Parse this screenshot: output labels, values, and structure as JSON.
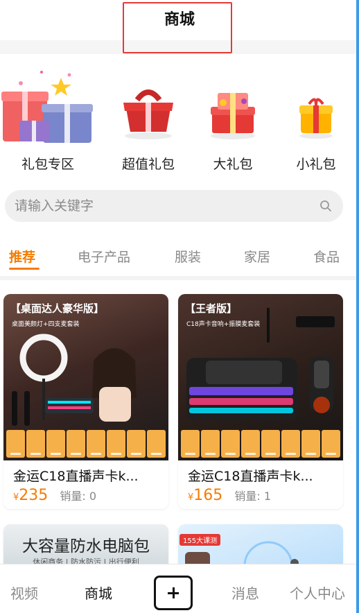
{
  "header": {
    "title": "商城"
  },
  "gift_categories": [
    {
      "label": "礼包专区",
      "icon": "gift-pile-icon"
    },
    {
      "label": "超值礼包",
      "icon": "red-gift-box-icon"
    },
    {
      "label": "大礼包",
      "icon": "big-gift-box-icon"
    },
    {
      "label": "小礼包",
      "icon": "small-gift-box-icon"
    }
  ],
  "search": {
    "placeholder": "请输入关键字",
    "value": "",
    "icon": "search-icon"
  },
  "tabs": [
    {
      "label": "推荐",
      "active": true
    },
    {
      "label": "电子产品",
      "active": false
    },
    {
      "label": "服装",
      "active": false
    },
    {
      "label": "家居",
      "active": false
    },
    {
      "label": "食品",
      "active": false
    }
  ],
  "products": [
    {
      "badge": "【桌面达人豪华版】",
      "badge_sub": "桌面美颜灯+四支麦套装",
      "title": "金运C18直播声卡k...",
      "currency": "¥",
      "price": "235",
      "sales_label": "销量:",
      "sales_count": "0"
    },
    {
      "badge": "【王者版】",
      "badge_sub": "C18声卡音响+振膜麦套装",
      "title": "金运C18直播声卡k...",
      "currency": "¥",
      "price": "165",
      "sales_label": "销量:",
      "sales_count": "1"
    },
    {
      "banner_text": "大容量防水电脑包",
      "banner_sub": "休闲商务 | 防水防污 | 出行便利"
    },
    {
      "badge": "155大课测"
    }
  ],
  "bottom_nav": [
    {
      "label": "视频",
      "active": false
    },
    {
      "label": "商城",
      "active": true
    },
    {
      "label": "+",
      "is_plus": true
    },
    {
      "label": "消息",
      "active": false
    },
    {
      "label": "个人中心",
      "active": false
    }
  ],
  "colors": {
    "accent": "#f57c00",
    "highlight_box": "#e53935",
    "side_strip": "#1e88e5"
  }
}
